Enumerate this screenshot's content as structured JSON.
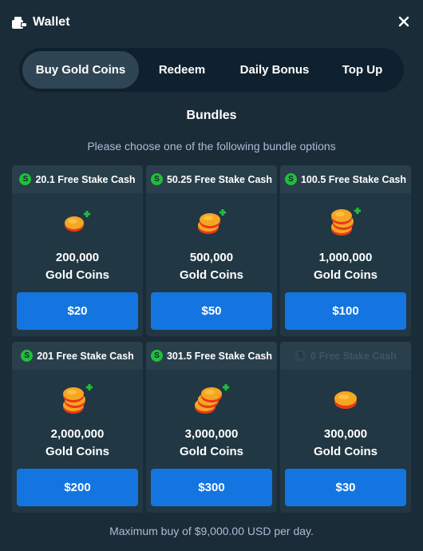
{
  "header": {
    "title": "Wallet",
    "wallet_icon": "wallet-icon",
    "close_icon": "close-icon"
  },
  "tabs": [
    {
      "label": "Buy Gold Coins",
      "active": true
    },
    {
      "label": "Redeem",
      "active": false
    },
    {
      "label": "Daily Bonus",
      "active": false
    },
    {
      "label": "Top Up",
      "active": false
    }
  ],
  "section": {
    "title": "Bundles",
    "subtitle": "Please choose one of the following bundle options"
  },
  "bundles": [
    {
      "bonus": "20.1 Free Stake Cash",
      "amount": "200,000",
      "unit": "Gold Coins",
      "price": "$20",
      "bonus_active": true
    },
    {
      "bonus": "50.25 Free Stake Cash",
      "amount": "500,000",
      "unit": "Gold Coins",
      "price": "$50",
      "bonus_active": true
    },
    {
      "bonus": "100.5 Free Stake Cash",
      "amount": "1,000,000",
      "unit": "Gold Coins",
      "price": "$100",
      "bonus_active": true
    },
    {
      "bonus": "201 Free Stake Cash",
      "amount": "2,000,000",
      "unit": "Gold Coins",
      "price": "$200",
      "bonus_active": true
    },
    {
      "bonus": "301.5 Free Stake Cash",
      "amount": "3,000,000",
      "unit": "Gold Coins",
      "price": "$300",
      "bonus_active": true
    },
    {
      "bonus": "0 Free Stake Cash",
      "amount": "300,000",
      "unit": "Gold Coins",
      "price": "$30",
      "bonus_active": false
    }
  ],
  "badge_letter": "S",
  "footer": {
    "note": "Maximum buy of $9,000.00 USD per day."
  },
  "colors": {
    "background": "#1a2c38",
    "panel": "#213743",
    "accent_blue": "#1475e1",
    "bonus_green": "#1fbf3a",
    "coin_gold": "#f5a623",
    "coin_red": "#e8391a"
  }
}
